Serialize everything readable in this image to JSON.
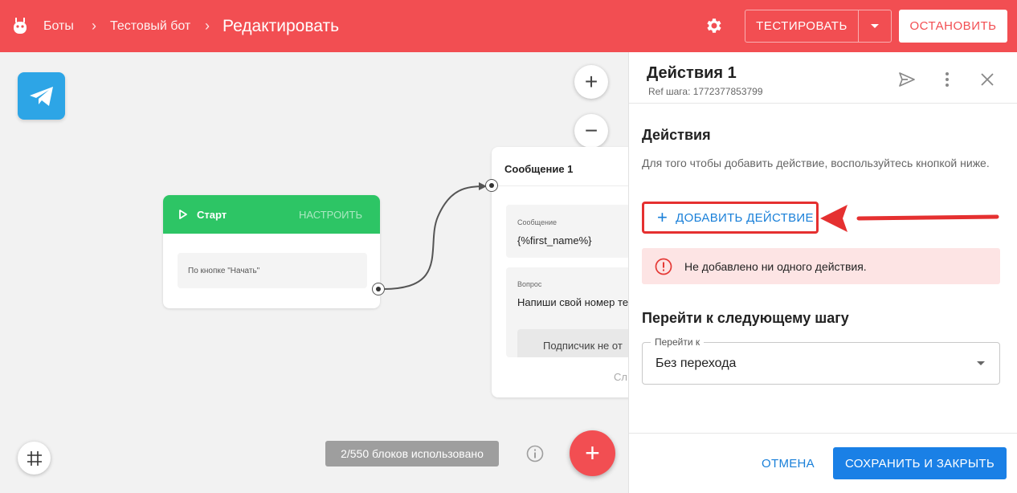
{
  "header": {
    "logo_icon": "bot-icon",
    "breadcrumbs": [
      {
        "label": "Боты"
      },
      {
        "label": "Тестовый бот"
      },
      {
        "label": "Редактировать"
      }
    ],
    "settings_icon": "gear-icon",
    "test_label": "ТЕСТИРОВАТЬ",
    "stop_label": "ОСТАНОВИТЬ",
    "accent_color": "#f24e52"
  },
  "canvas": {
    "channel_icon": "telegram-icon",
    "zoom_in": "+",
    "zoom_out": "−",
    "start_node": {
      "title": "Старт",
      "configure_label": "НАСТРОИТЬ",
      "trigger": "По кнопке \"Начать\""
    },
    "message_node": {
      "title": "Сообщение 1",
      "message_caption": "Сообщение",
      "message_text": "{%first_name%}",
      "question_caption": "Вопрос",
      "question_text": "Напиши свой номер те",
      "answer_text": "Подписчик не от",
      "next_label": "Сл"
    },
    "blocks_used": "2/550 блоков использовано",
    "add_button": "+"
  },
  "panel": {
    "title": "Действия 1",
    "ref": "Ref шага: 1772377853799",
    "actions_heading": "Действия",
    "actions_hint": "Для того чтобы добавить действие, воспользуйтесь кнопкой ниже.",
    "add_action_label": "ДОБАВИТЬ ДЕЙСТВИЕ",
    "empty_warning": "Не добавлено ни одного действия.",
    "next_step_heading": "Перейти к следующему шагу",
    "goto_label": "Перейти к",
    "goto_value": "Без перехода",
    "cancel_label": "ОТМЕНА",
    "save_label": "СОХРАНИТЬ И ЗАКРЫТЬ"
  }
}
